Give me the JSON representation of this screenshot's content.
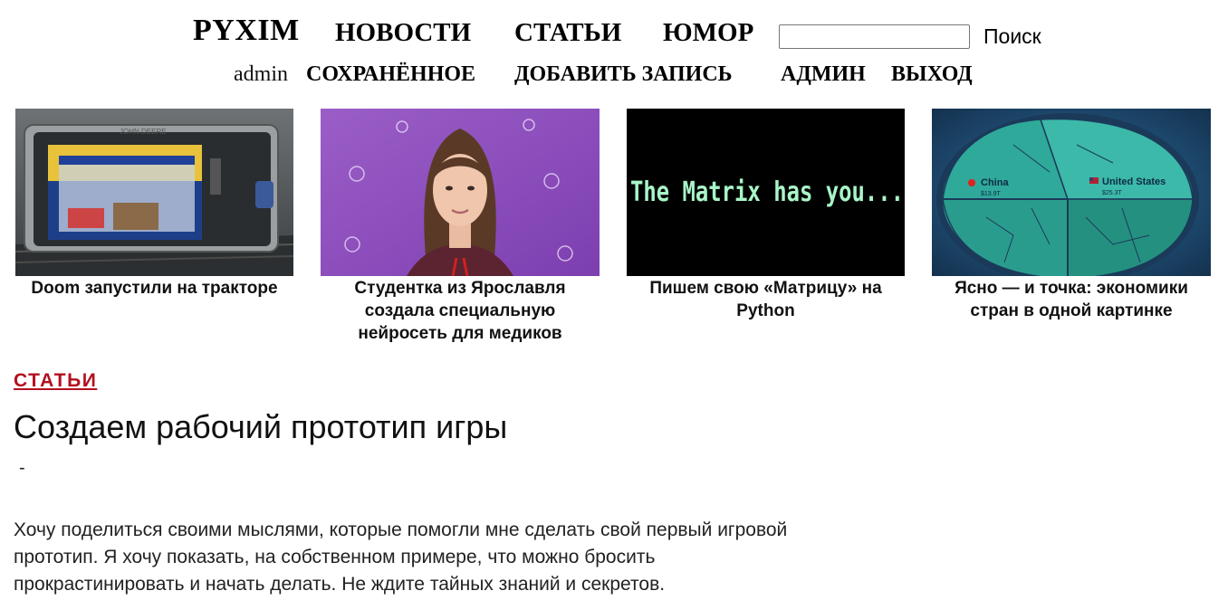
{
  "header": {
    "logo": "PYXIM",
    "nav": {
      "news": "НОВОСТИ",
      "articles": "СТАТЬИ",
      "humor": "ЮМОР"
    },
    "search": {
      "value": "",
      "placeholder": "",
      "label": "Поиск"
    },
    "user": {
      "name": "admin",
      "saved": "СОХРАНЁННОЕ",
      "add_post": "ДОБАВИТЬ ЗАПИСЬ",
      "admin": "АДМИН",
      "logout": "ВЫХОД"
    }
  },
  "featured": [
    {
      "title": "Doom запустили на тракторе"
    },
    {
      "title": "Студентка из Ярославля создала специальную нейросеть для медиков"
    },
    {
      "title": "Пишем свою «Матрицу» на Python",
      "image_text": "The Matrix has you..."
    },
    {
      "title": "Ясно — и точка: экономики стран в одной картинке",
      "image_labels": {
        "china": "China",
        "china_value": "$13.9T",
        "usa": "United States",
        "usa_value": "$25.3T"
      }
    }
  ],
  "article": {
    "category": "СТАТЬИ",
    "title": "Создаем рабочий прототип игры",
    "dash": "-",
    "lead": "Хочу поделиться своими мыслями, которые помогли мне сделать свой первый игровой прототип. Я хочу показать, на собственном примере, что можно бросить прокрастинировать и начать делать. Не ждите тайных знаний и секретов."
  },
  "colors": {
    "accent": "#b3101e",
    "text": "#111111",
    "matrix_green": "#a9f5c8",
    "matrix_bg": "#000000",
    "purple_bg": "#a05fc8",
    "teal_map": "#2fa99a"
  },
  "icons": {
    "search": "search-field"
  }
}
